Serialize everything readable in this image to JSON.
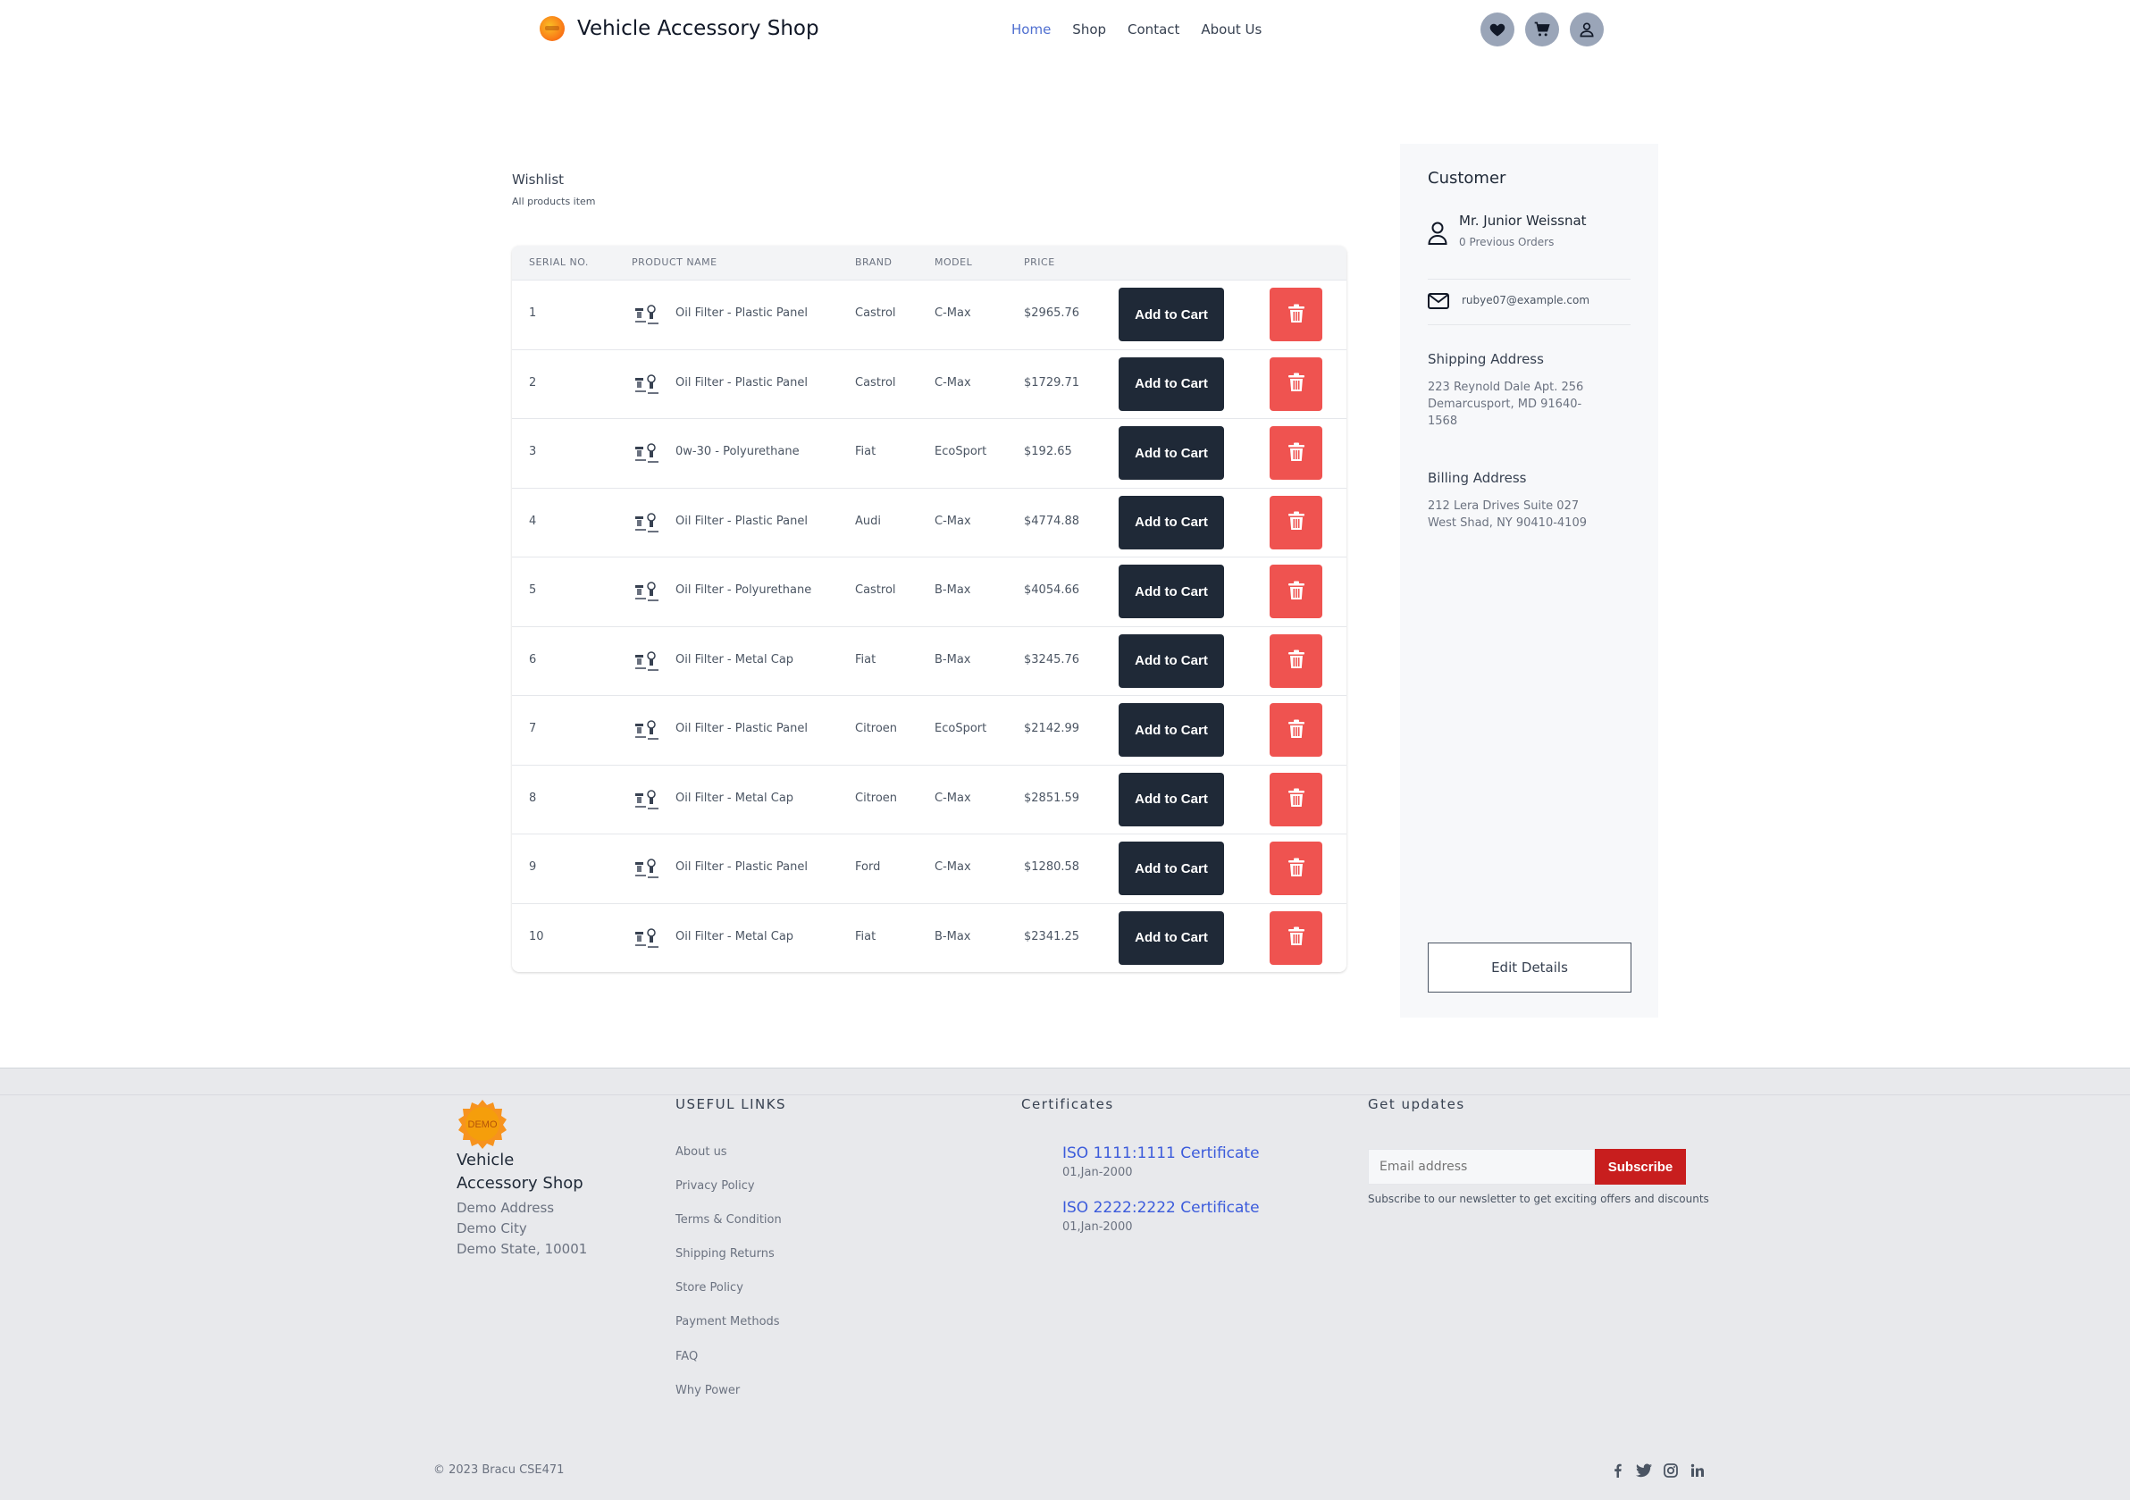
{
  "header": {
    "brand": "Vehicle Accessory Shop",
    "nav": [
      "Home",
      "Shop",
      "Contact",
      "About Us"
    ],
    "active_nav": "Home"
  },
  "wishlist": {
    "title": "Wishlist",
    "subtitle": "All products item",
    "columns": [
      "SERIAL NO.",
      "PRODUCT NAME",
      "BRAND",
      "MODEL",
      "PRICE"
    ],
    "add_to_cart_label": "Add to Cart",
    "rows": [
      {
        "serial": "1",
        "name": "Oil Filter - Plastic Panel",
        "brand": "Castrol",
        "model": "C-Max",
        "price": "$2965.76"
      },
      {
        "serial": "2",
        "name": "Oil Filter - Plastic Panel",
        "brand": "Castrol",
        "model": "C-Max",
        "price": "$1729.71"
      },
      {
        "serial": "3",
        "name": "0w-30 - Polyurethane",
        "brand": "Fiat",
        "model": "EcoSport",
        "price": "$192.65"
      },
      {
        "serial": "4",
        "name": "Oil Filter - Plastic Panel",
        "brand": "Audi",
        "model": "C-Max",
        "price": "$4774.88"
      },
      {
        "serial": "5",
        "name": "Oil Filter - Polyurethane",
        "brand": "Castrol",
        "model": "B-Max",
        "price": "$4054.66"
      },
      {
        "serial": "6",
        "name": "Oil Filter - Metal Cap",
        "brand": "Fiat",
        "model": "B-Max",
        "price": "$3245.76"
      },
      {
        "serial": "7",
        "name": "Oil Filter - Plastic Panel",
        "brand": "Citroen",
        "model": "EcoSport",
        "price": "$2142.99"
      },
      {
        "serial": "8",
        "name": "Oil Filter - Metal Cap",
        "brand": "Citroen",
        "model": "C-Max",
        "price": "$2851.59"
      },
      {
        "serial": "9",
        "name": "Oil Filter - Plastic Panel",
        "brand": "Ford",
        "model": "C-Max",
        "price": "$1280.58"
      },
      {
        "serial": "10",
        "name": "Oil Filter - Metal Cap",
        "brand": "Fiat",
        "model": "B-Max",
        "price": "$2341.25"
      }
    ]
  },
  "customer": {
    "title": "Customer",
    "name": "Mr. Junior Weissnat",
    "orders": "0 Previous Orders",
    "email": "rubye07@example.com",
    "shipping_heading": "Shipping Address",
    "shipping_address": "223 Reynold Dale Apt. 256 Demarcusport, MD 91640-1568",
    "billing_heading": "Billing Address",
    "billing_address": "212 Lera Drives Suite 027 West Shad, NY 90410-4109",
    "edit_label": "Edit Details"
  },
  "footer": {
    "logo_text": "DEMO",
    "shop_name": "Vehicle Accessory Shop",
    "address_lines": [
      "Demo Address",
      "Demo City",
      "Demo State, 10001"
    ],
    "useful_links_heading": "USEFUL LINKS",
    "useful_links": [
      "About us",
      "Privacy Policy",
      "Terms & Condition",
      "Shipping Returns",
      "Store Policy",
      "Payment Methods",
      "FAQ",
      "Why Power"
    ],
    "certificates_heading": "Certificates",
    "certificates": [
      {
        "name": "ISO 1111:1111 Certificate",
        "date": "01,Jan-2000"
      },
      {
        "name": "ISO 2222:2222 Certificate",
        "date": "01,Jan-2000"
      }
    ],
    "updates_heading": "Get updates",
    "email_placeholder": "Email address",
    "subscribe_label": "Subscribe",
    "subscribe_note": "Subscribe to our newsletter to get exciting offers and discounts",
    "copyright": "© 2023 Bracu CSE471",
    "social_icons": [
      "facebook-icon",
      "twitter-icon",
      "instagram-icon",
      "linkedin-icon"
    ]
  },
  "colors": {
    "accent_nav": "#4f6fd0",
    "dark_button": "#1f2937",
    "delete_button": "#ef5350",
    "subscribe_button": "#c81e1e"
  }
}
